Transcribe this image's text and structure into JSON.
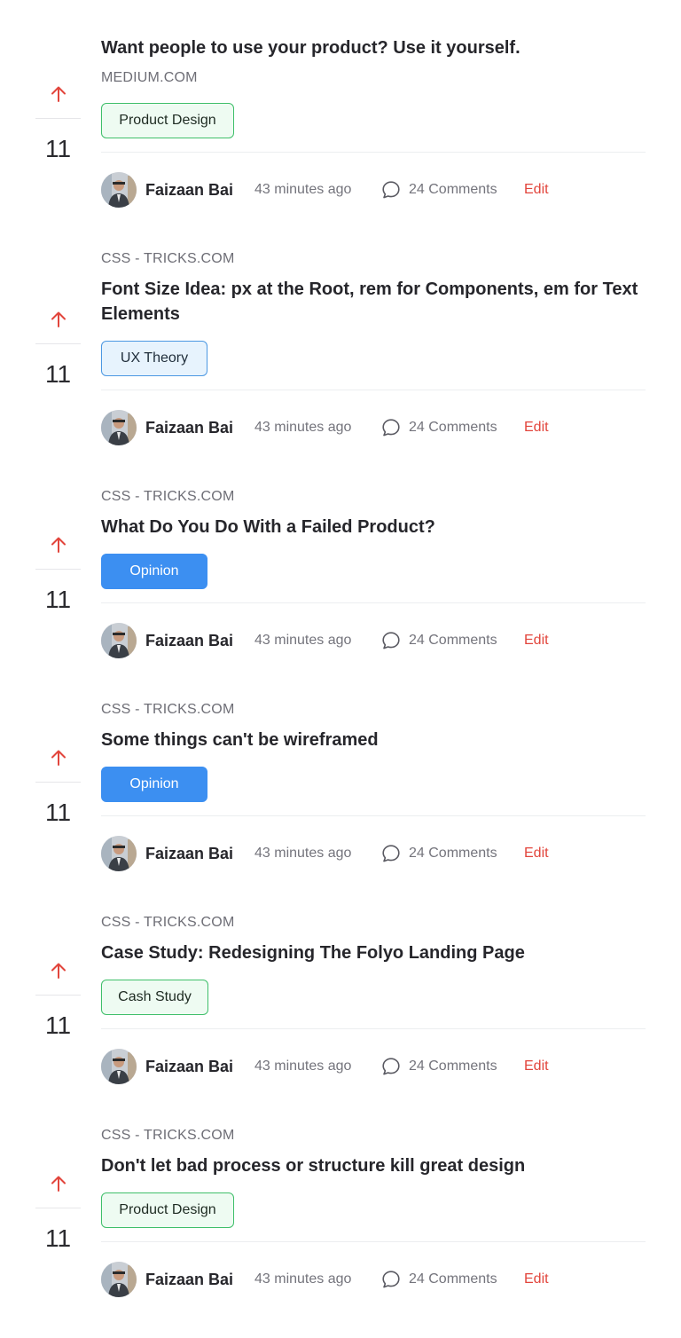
{
  "colors": {
    "upvote_arrow": "#e2453c",
    "edit_link": "#e2453c",
    "tag_green_border": "#3fbf6a",
    "tag_blue_border": "#4c98e2",
    "tag_blue_solid": "#3c8ff1"
  },
  "posts": [
    {
      "source": "",
      "title": "Want people to use your product? Use it yourself.",
      "tag": "Product Design",
      "votes": "11",
      "author": "Faizaan Bai",
      "time": "43 minutes ago",
      "comments": "24 Comments",
      "edit": "Edit",
      "top_source": "MEDIUM.COM"
    },
    {
      "source": "CSS - TRICKS.COM",
      "title": "Font Size Idea: px at the Root, rem for Components, em for Text Elements",
      "tag": "UX Theory",
      "votes": "11",
      "author": "Faizaan Bai",
      "time": "43 minutes ago",
      "comments": "24 Comments",
      "edit": "Edit"
    },
    {
      "source": "CSS - TRICKS.COM",
      "title": "What Do You Do With a Failed Product?",
      "tag": "Opinion",
      "votes": "11",
      "author": "Faizaan Bai",
      "time": "43 minutes ago",
      "comments": "24 Comments",
      "edit": "Edit"
    },
    {
      "source": "CSS - TRICKS.COM",
      "title": "Some things can't be wireframed",
      "tag": "Opinion",
      "votes": "11",
      "author": "Faizaan Bai",
      "time": "43 minutes ago",
      "comments": "24 Comments",
      "edit": "Edit"
    },
    {
      "source": "CSS - TRICKS.COM",
      "title": "Case Study: Redesigning The Folyo Landing Page",
      "tag": "Cash Study",
      "votes": "11",
      "author": "Faizaan Bai",
      "time": "43 minutes ago",
      "comments": "24 Comments",
      "edit": "Edit"
    },
    {
      "source": "CSS - TRICKS.COM",
      "title": "Don't let bad process or structure kill great design",
      "tag": "Product Design",
      "votes": "11",
      "author": "Faizaan Bai",
      "time": "43 minutes ago",
      "comments": "24 Comments",
      "edit": "Edit"
    }
  ]
}
